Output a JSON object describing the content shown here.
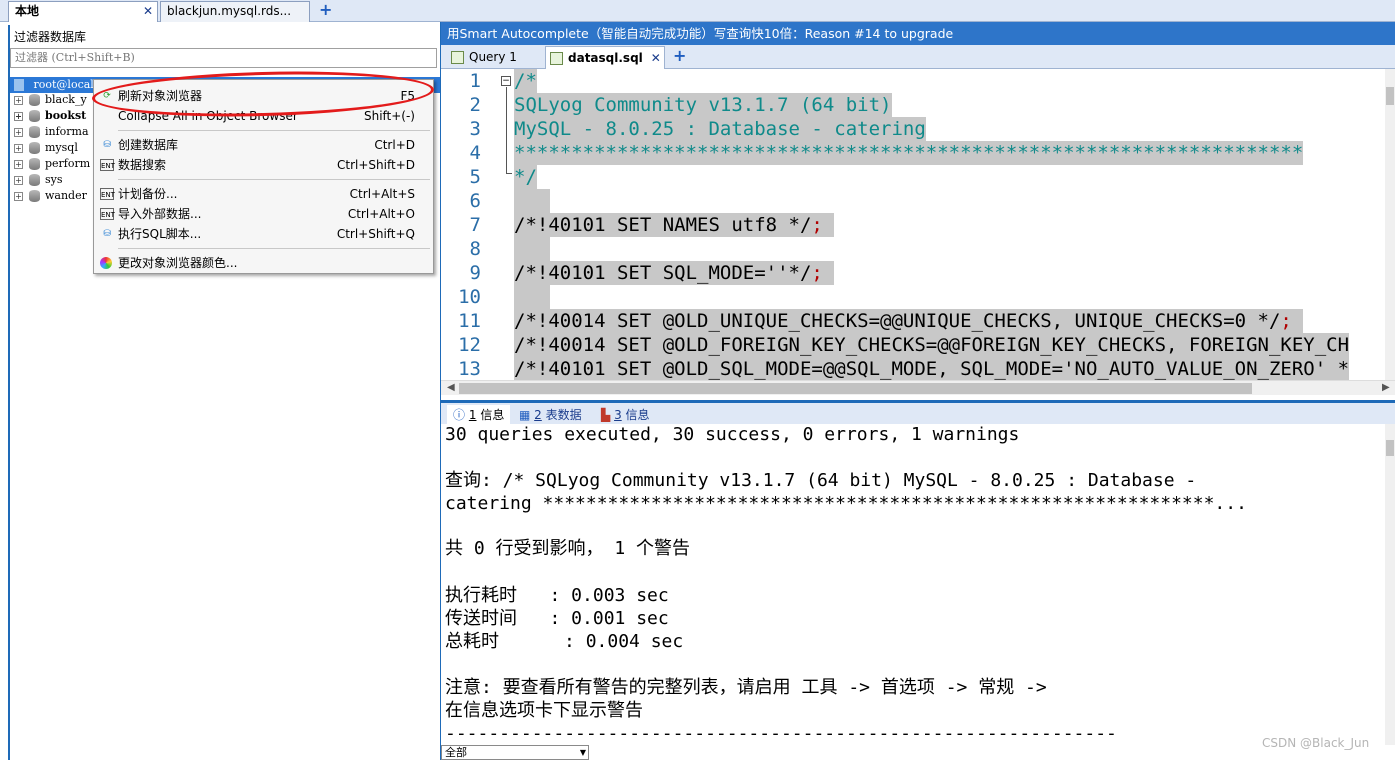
{
  "connection_tabs": [
    {
      "label": "本地",
      "active": true
    },
    {
      "label": "blackjun.mysql.rds...",
      "active": false
    }
  ],
  "left": {
    "filter_title": "过滤器数据库",
    "filter_placeholder": "过滤器 (Ctrl+Shift+B)",
    "root": "root@locall",
    "databases": [
      "black_y",
      "bookst",
      "informa",
      "mysql",
      "perform",
      "sys",
      "wander"
    ]
  },
  "context_menu": {
    "items": [
      {
        "label": "刷新对象浏览器",
        "shortcut": "F5",
        "icon": "refresh-icon"
      },
      {
        "label": "Collapse All in Object Browser",
        "shortcut": "Shift+(-)",
        "icon": ""
      },
      {
        "label": "创建数据库",
        "shortcut": "Ctrl+D",
        "icon": "create-db-icon"
      },
      {
        "label": "数据搜索",
        "shortcut": "Ctrl+Shift+D",
        "icon": "search-icon"
      },
      {
        "label": "计划备份...",
        "shortcut": "Ctrl+Alt+S",
        "icon": "backup-icon"
      },
      {
        "label": "导入外部数据...",
        "shortcut": "Ctrl+Alt+O",
        "icon": "import-icon"
      },
      {
        "label": "执行SQL脚本...",
        "shortcut": "Ctrl+Shift+Q",
        "icon": "run-sql-icon"
      },
      {
        "label": "更改对象浏览器颜色...",
        "shortcut": "",
        "icon": "color-icon"
      }
    ]
  },
  "upgrade_banner": "用Smart Autocomplete（智能自动完成功能）写查询快10倍：Reason #14 to upgrade",
  "editor_tabs": [
    {
      "label": "Query 1",
      "active": false
    },
    {
      "label": "datasql.sql",
      "active": true
    }
  ],
  "editor": {
    "line_numbers": [
      "1",
      "2",
      "3",
      "4",
      "5",
      "6",
      "7",
      "8",
      "9",
      "10",
      "11",
      "12",
      "13"
    ],
    "lines": [
      "/*",
      "SQLyog Community v13.1.7 (64 bit)",
      "MySQL - 8.0.25 : Database - catering",
      "*********************************************************************",
      "*/",
      "",
      "/*!40101 SET NAMES utf8 */",
      "",
      "/*!40101 SET SQL_MODE=''*/",
      "",
      "/*!40014 SET @OLD_UNIQUE_CHECKS=@@UNIQUE_CHECKS, UNIQUE_CHECKS=0 */",
      "/*!40014 SET @OLD_FOREIGN_KEY_CHECKS=@@FOREIGN_KEY_CHECKS, FOREIGN_KEY_CH",
      "/*!40101 SET @OLD_SQL_MODE=@@SQL_MODE, SQL_MODE='NO_AUTO_VALUE_ON_ZERO' *"
    ],
    "semicolon": ";"
  },
  "result_tabs": [
    {
      "num": "1",
      "label": "信息",
      "active": true
    },
    {
      "num": "2",
      "label": "表数据",
      "active": false
    },
    {
      "num": "3",
      "label": "信息",
      "active": false
    }
  ],
  "results": {
    "summary": "30 queries executed, 30 success, 0 errors, 1 warnings",
    "query_line1": "查询: /* SQLyog Community v13.1.7 (64 bit) MySQL - 8.0.25 : Database -",
    "query_line2": "catering **************************************************************...",
    "affected": "共 0 行受到影响， 1 个警告",
    "exec_time": "执行耗时   : 0.003 sec",
    "transfer_time": "传送时间   : 0.001 sec",
    "total_time": "总耗时      : 0.004 sec",
    "note_line1": "注意: 要查看所有警告的完整列表，请启用 工具 -> 首选项 -> 常规 ->",
    "note_line2": "在信息选项卡下显示警告",
    "separator": "--------------------------------------------------------------"
  },
  "bottom_select": "全部",
  "watermark": "CSDN @Black_Jun",
  "colors": {
    "accent": "#2e75c9",
    "annotation_red": "#e31b1b",
    "comment_teal": "#0f8a8a"
  }
}
